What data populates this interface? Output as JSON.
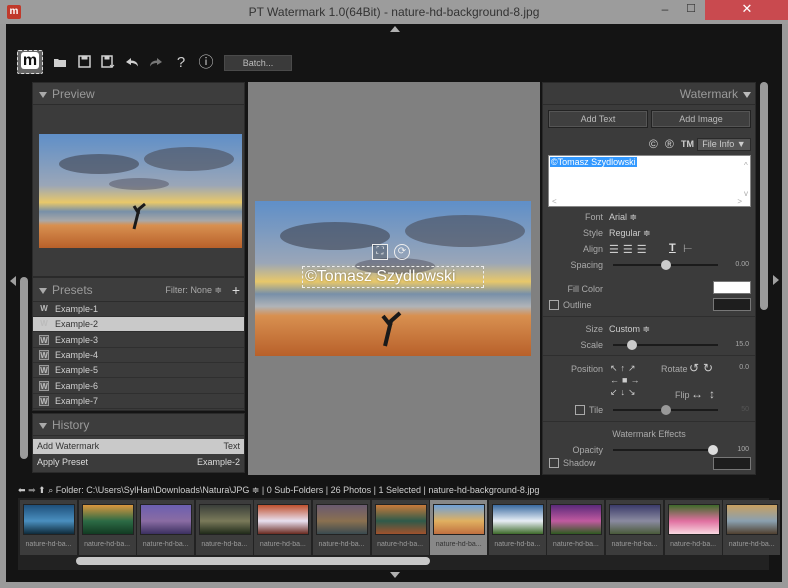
{
  "window": {
    "title": "PT Watermark 1.0(64Bit) - nature-hd-background-8.jpg",
    "app_icon": "m",
    "minimize": "–",
    "maximize": "☐",
    "close": "✕"
  },
  "toolbar": {
    "logo": "m",
    "icons": [
      "open-folder-icon",
      "save-icon",
      "save-as-icon",
      "undo-icon",
      "redo-icon",
      "help-icon",
      "info-icon"
    ],
    "icon_glyphs": {
      "open": "▬",
      "save": "💾",
      "save_as": "💾",
      "undo": "↶",
      "redo": "↷",
      "help": "?",
      "info": "ⓘ"
    },
    "batch_label": "Batch..."
  },
  "preview": {
    "title": "Preview"
  },
  "presets": {
    "title": "Presets",
    "filter_label": "Filter:",
    "filter_value": "None ≑",
    "add": "+",
    "items": [
      {
        "label": "Example-1",
        "selected": false
      },
      {
        "label": "Example-2",
        "selected": true
      },
      {
        "label": "Example-3",
        "selected": false
      },
      {
        "label": "Example-4",
        "selected": false
      },
      {
        "label": "Example-5",
        "selected": false
      },
      {
        "label": "Example-6",
        "selected": false
      },
      {
        "label": "Example-7",
        "selected": false
      }
    ]
  },
  "history": {
    "title": "History",
    "items": [
      {
        "action": "Add Watermark",
        "detail": "Text",
        "selected": true
      },
      {
        "action": "Apply Preset",
        "detail": "Example-2",
        "selected": false
      }
    ]
  },
  "canvas": {
    "watermark_text": "©Tomasz Szydlowski"
  },
  "watermark_panel": {
    "title": "Watermark",
    "add_text": "Add Text",
    "add_image": "Add Image",
    "symbols": [
      "©",
      "®",
      "TM"
    ],
    "file_info": "File Info ▼",
    "text_value": "©Tomasz Szydlowski",
    "font_label": "Font",
    "font_value": "Arial ≑",
    "style_label": "Style",
    "style_value": "Regular ≑",
    "align_label": "Align",
    "spacing_label": "Spacing",
    "spacing_value": "0.00",
    "spacing_fraction": 0.5,
    "fill_label": "Fill Color",
    "fill_color": "#ffffff",
    "outline_label": "Outline",
    "outline_color": "#1e1e1e",
    "size_label": "Size",
    "size_value": "Custom ≑",
    "scale_label": "Scale",
    "scale_value": "15.0",
    "scale_fraction": 0.15,
    "position_label": "Position",
    "rotate_label": "Rotate",
    "rotate_value": "0.0",
    "flip_label": "Flip",
    "tile_label": "Tile",
    "tile_value": "50",
    "tile_fraction": 0.5,
    "effects_title": "Watermark Effects",
    "opacity_label": "Opacity",
    "opacity_value": "100",
    "opacity_fraction": 1.0,
    "shadow_label": "Shadow",
    "shadow_color": "#1e1e1e"
  },
  "pathbar": {
    "folder_label": "Folder:",
    "path": "C:\\Users\\SylHan\\Downloads\\Natura\\JPG ≑",
    "info": "| 0 Sub-Folders | 26 Photos | 1 Selected | nature-hd-background-8.jpg"
  },
  "filmstrip": {
    "items": [
      {
        "caption": "nature-hd-ba...",
        "colors": [
          "#1e4f7a",
          "#4a8fbf",
          "#0f2a3a"
        ],
        "selected": false
      },
      {
        "caption": "nature-hd-ba...",
        "colors": [
          "#d9963e",
          "#2c6b45",
          "#123a22"
        ],
        "selected": false
      },
      {
        "caption": "nature-hd-ba...",
        "colors": [
          "#6b5fb0",
          "#8a6ca3",
          "#3b3060"
        ],
        "selected": false
      },
      {
        "caption": "nature-hd-ba...",
        "colors": [
          "#3a3f3a",
          "#7a7a5a",
          "#1f2a1a"
        ],
        "selected": false
      },
      {
        "caption": "nature-hd-ba...",
        "colors": [
          "#c0502e",
          "#e8e0f0",
          "#6a2a20"
        ],
        "selected": false
      },
      {
        "caption": "nature-hd-ba...",
        "colors": [
          "#6a5a70",
          "#8a7050",
          "#3a4a50"
        ],
        "selected": false
      },
      {
        "caption": "nature-hd-ba...",
        "colors": [
          "#c87a3a",
          "#2e5a4a",
          "#a0522d"
        ],
        "selected": false
      },
      {
        "caption": "nature-hd-ba...",
        "colors": [
          "#6fa0d8",
          "#e0b060",
          "#c07040"
        ],
        "selected": true
      },
      {
        "caption": "nature-hd-ba...",
        "colors": [
          "#3a6aa0",
          "#e8eef5",
          "#3e6a2a"
        ],
        "selected": false
      },
      {
        "caption": "nature-hd-ba...",
        "colors": [
          "#5a2a7a",
          "#c05aa0",
          "#2e5a20"
        ],
        "selected": false
      },
      {
        "caption": "nature-hd-ba...",
        "colors": [
          "#3a3a6a",
          "#8a8aa0",
          "#4a5a3a"
        ],
        "selected": false
      },
      {
        "caption": "nature-hd-ba...",
        "colors": [
          "#3e6a2a",
          "#e070a0",
          "#f8d8e0"
        ],
        "selected": false
      },
      {
        "caption": "nature-hd-ba...",
        "colors": [
          "#c8a060",
          "#8aa0b0",
          "#504030"
        ],
        "selected": false
      }
    ]
  }
}
